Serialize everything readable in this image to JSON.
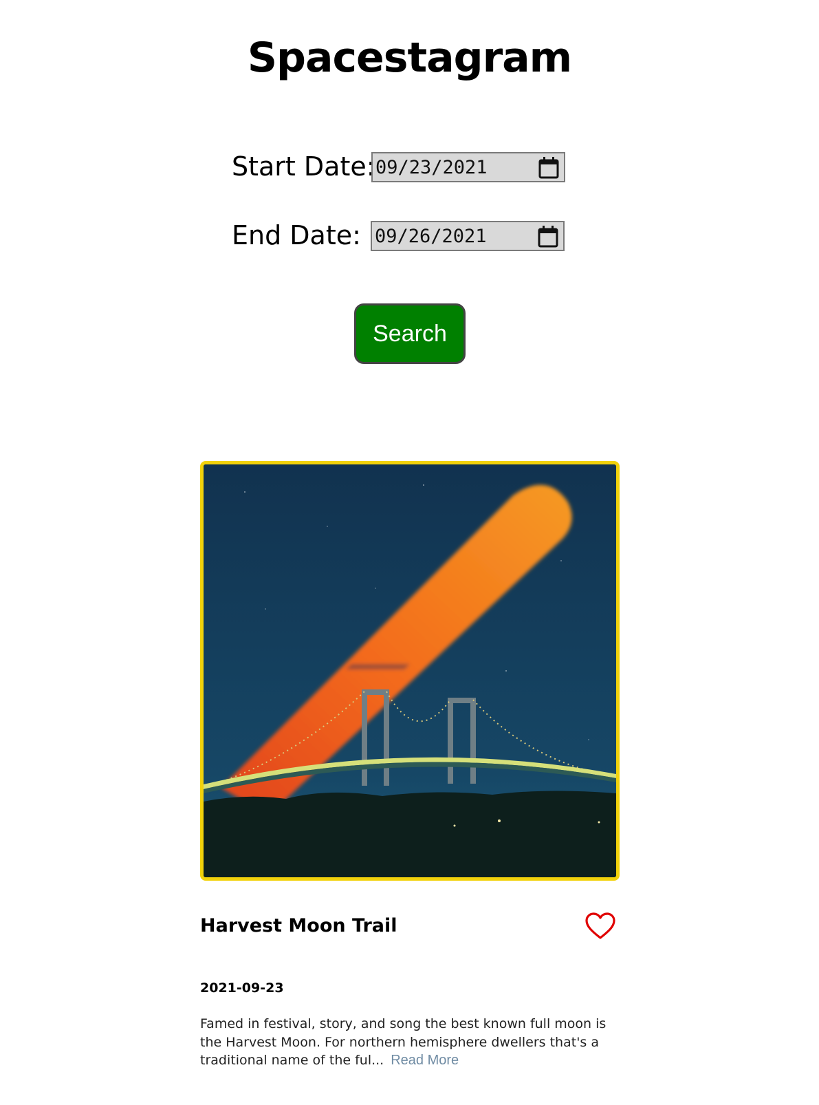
{
  "header": {
    "title": "Spacestagram"
  },
  "search_form": {
    "start_label": "Start Date:",
    "start_value": "09/23/2021",
    "end_label": "End Date:",
    "end_value": "09/26/2021",
    "search_label": "Search",
    "calendar_icon": "calendar-icon",
    "button_color": "#008000"
  },
  "post": {
    "image_subject": "harvest-moon-trail-over-bridge",
    "border_color": "#f2d20b",
    "title": "Harvest Moon Trail",
    "like_icon": "heart-icon",
    "like_color": "#e00000",
    "date": "2021-09-23",
    "description": "Famed in festival, story, and song the best known full moon is the Harvest Moon. For northern hemisphere dwellers that's a traditional name of the ful...",
    "read_more_label": "Read More"
  }
}
